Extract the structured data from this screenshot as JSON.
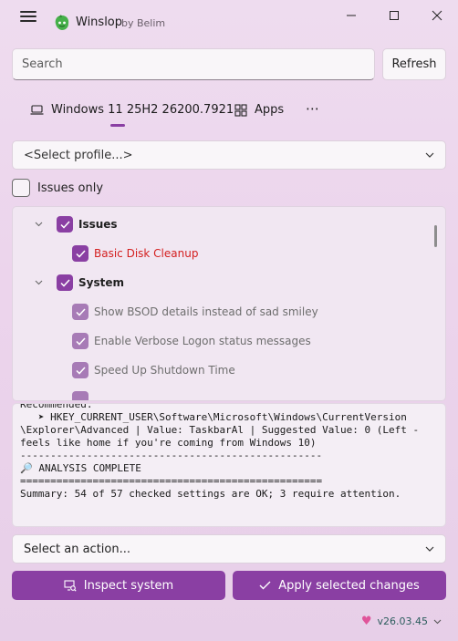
{
  "titlebar": {
    "app_name": "Winslop",
    "app_sub": "by Belim"
  },
  "search": {
    "placeholder": "Search"
  },
  "refresh_label": "Refresh",
  "tabs": [
    {
      "label": "Windows 11 25H2 26200.7921",
      "icon": "laptop-icon"
    },
    {
      "label": "Apps",
      "icon": "apps-grid-icon"
    },
    {
      "label": "⋯",
      "icon": "more-icon"
    }
  ],
  "profile": {
    "selected": "<Select profile...>"
  },
  "issues_only_label": "Issues only",
  "tree": {
    "groups": [
      {
        "label": "Issues",
        "items": [
          {
            "label": "Basic Disk Cleanup"
          }
        ]
      },
      {
        "label": "System",
        "items": [
          {
            "label": "Show BSOD details instead of sad smiley"
          },
          {
            "label": "Enable Verbose Logon status messages"
          },
          {
            "label": "Speed Up Shutdown Time"
          }
        ]
      }
    ]
  },
  "log": {
    "text": "Recommended:\n   ➤ HKEY_CURRENT_USER\\Software\\Microsoft\\Windows\\CurrentVersion\n\\Explorer\\Advanced | Value: TaskbarAl | Suggested Value: 0 (Left -\nfeels like home if you're coming from Windows 10)\n--------------------------------------------------\n🔎 ANALYSIS COMPLETE\n==================================================\nSummary: 54 of 57 checked settings are OK; 3 require attention."
  },
  "action": {
    "selected": "Select an action..."
  },
  "buttons": {
    "inspect": "Inspect system",
    "apply": "Apply selected changes"
  },
  "version": "v26.03.45",
  "colors": {
    "accent": "#8a3fa3",
    "issue_red": "#d42020"
  }
}
